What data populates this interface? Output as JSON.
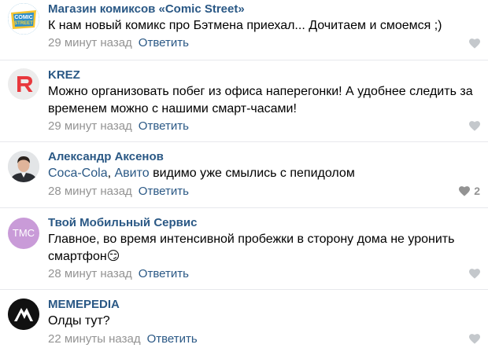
{
  "comments": [
    {
      "author": "Магазин комиксов «Comic Street»",
      "avatar_text": "COMIC STREET",
      "text": "К нам новый комикс про Бэтмена приехал... Дочитаем и смоемся ;)",
      "time": "29 минут назад",
      "reply_label": "Ответить",
      "likes": ""
    },
    {
      "author": "KREZ",
      "avatar_text": "R",
      "text": "Можно организовать побег из офиса наперегонки! А удобнее следить за временем можно с нашими смарт-часами!",
      "time": "29 минут назад",
      "reply_label": "Ответить",
      "likes": ""
    },
    {
      "author": "Александр Аксенов",
      "text_link_1": "Coca-Cola",
      "text_sep": ", ",
      "text_link_2": "Авито",
      "text_rest": " видимо уже смылись с пепидолом",
      "time": "28 минут назад",
      "reply_label": "Ответить",
      "likes": "2"
    },
    {
      "author": "Твой Мобильный Сервис",
      "avatar_text": "TMC",
      "text": "Главное, во время интенсивной пробежки в сторону дома не уронить смартфон",
      "emoji": "😏",
      "time": "28 минут назад",
      "reply_label": "Ответить",
      "likes": ""
    },
    {
      "author": "MEMEPEDIA",
      "text": "Олды тут?",
      "time": "22 минуты назад",
      "reply_label": "Ответить",
      "likes": ""
    }
  ],
  "colors": {
    "link": "#2a5885",
    "meta": "#939393",
    "like_icon": "#c4c8cc",
    "divider": "#e7e8ec"
  }
}
